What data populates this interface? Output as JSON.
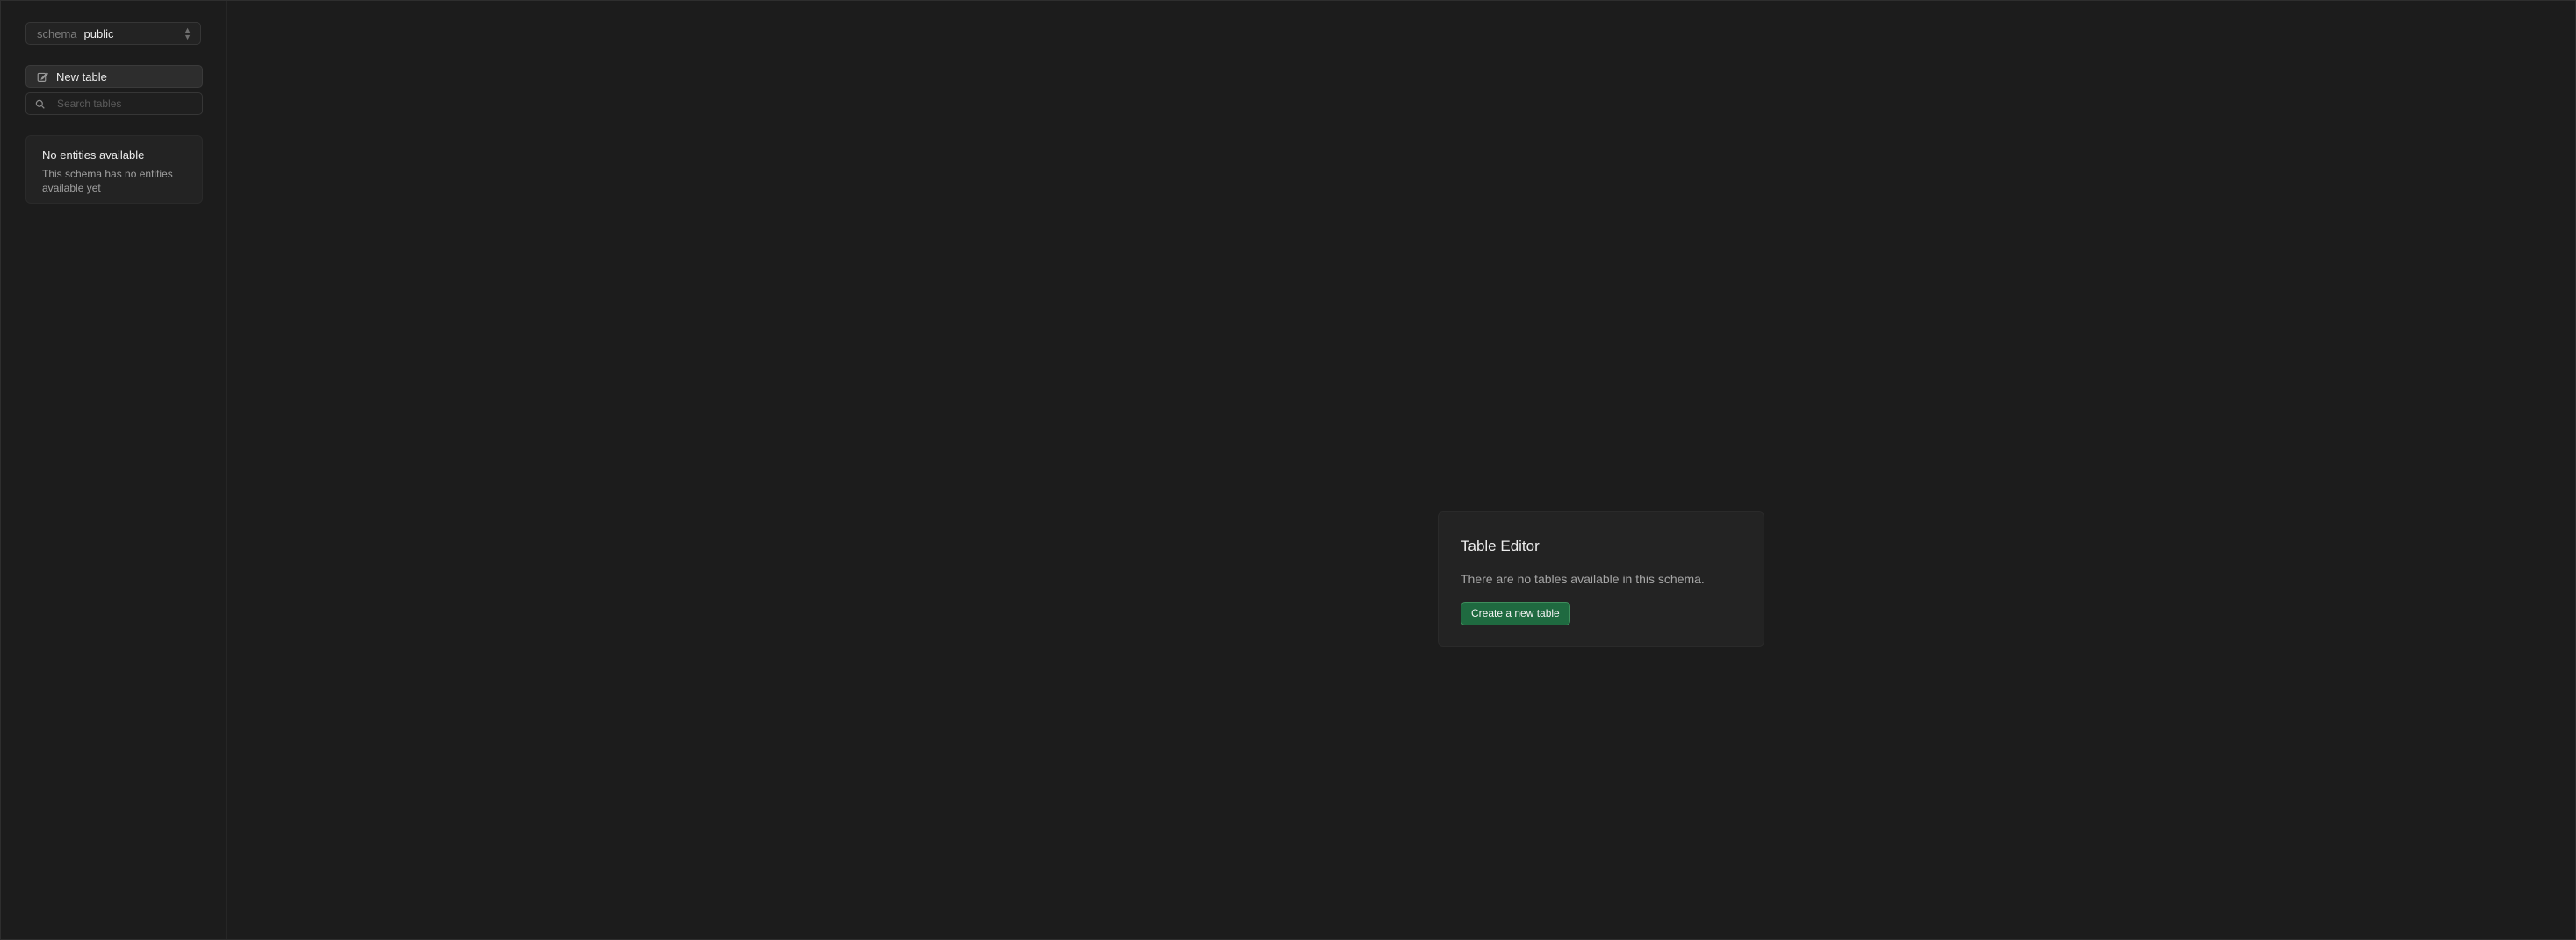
{
  "sidebar": {
    "schema": {
      "label": "schema",
      "value": "public"
    },
    "new_table_label": "New table",
    "search_placeholder": "Search tables",
    "empty": {
      "title": "No entities available",
      "description": "This schema has no entities available yet"
    }
  },
  "main": {
    "title": "Table Editor",
    "message": "There are no tables available in this schema.",
    "create_button_label": "Create a new table"
  },
  "colors": {
    "background": "#1c1c1c",
    "panel": "#232323",
    "accent": "#1f6a40"
  }
}
